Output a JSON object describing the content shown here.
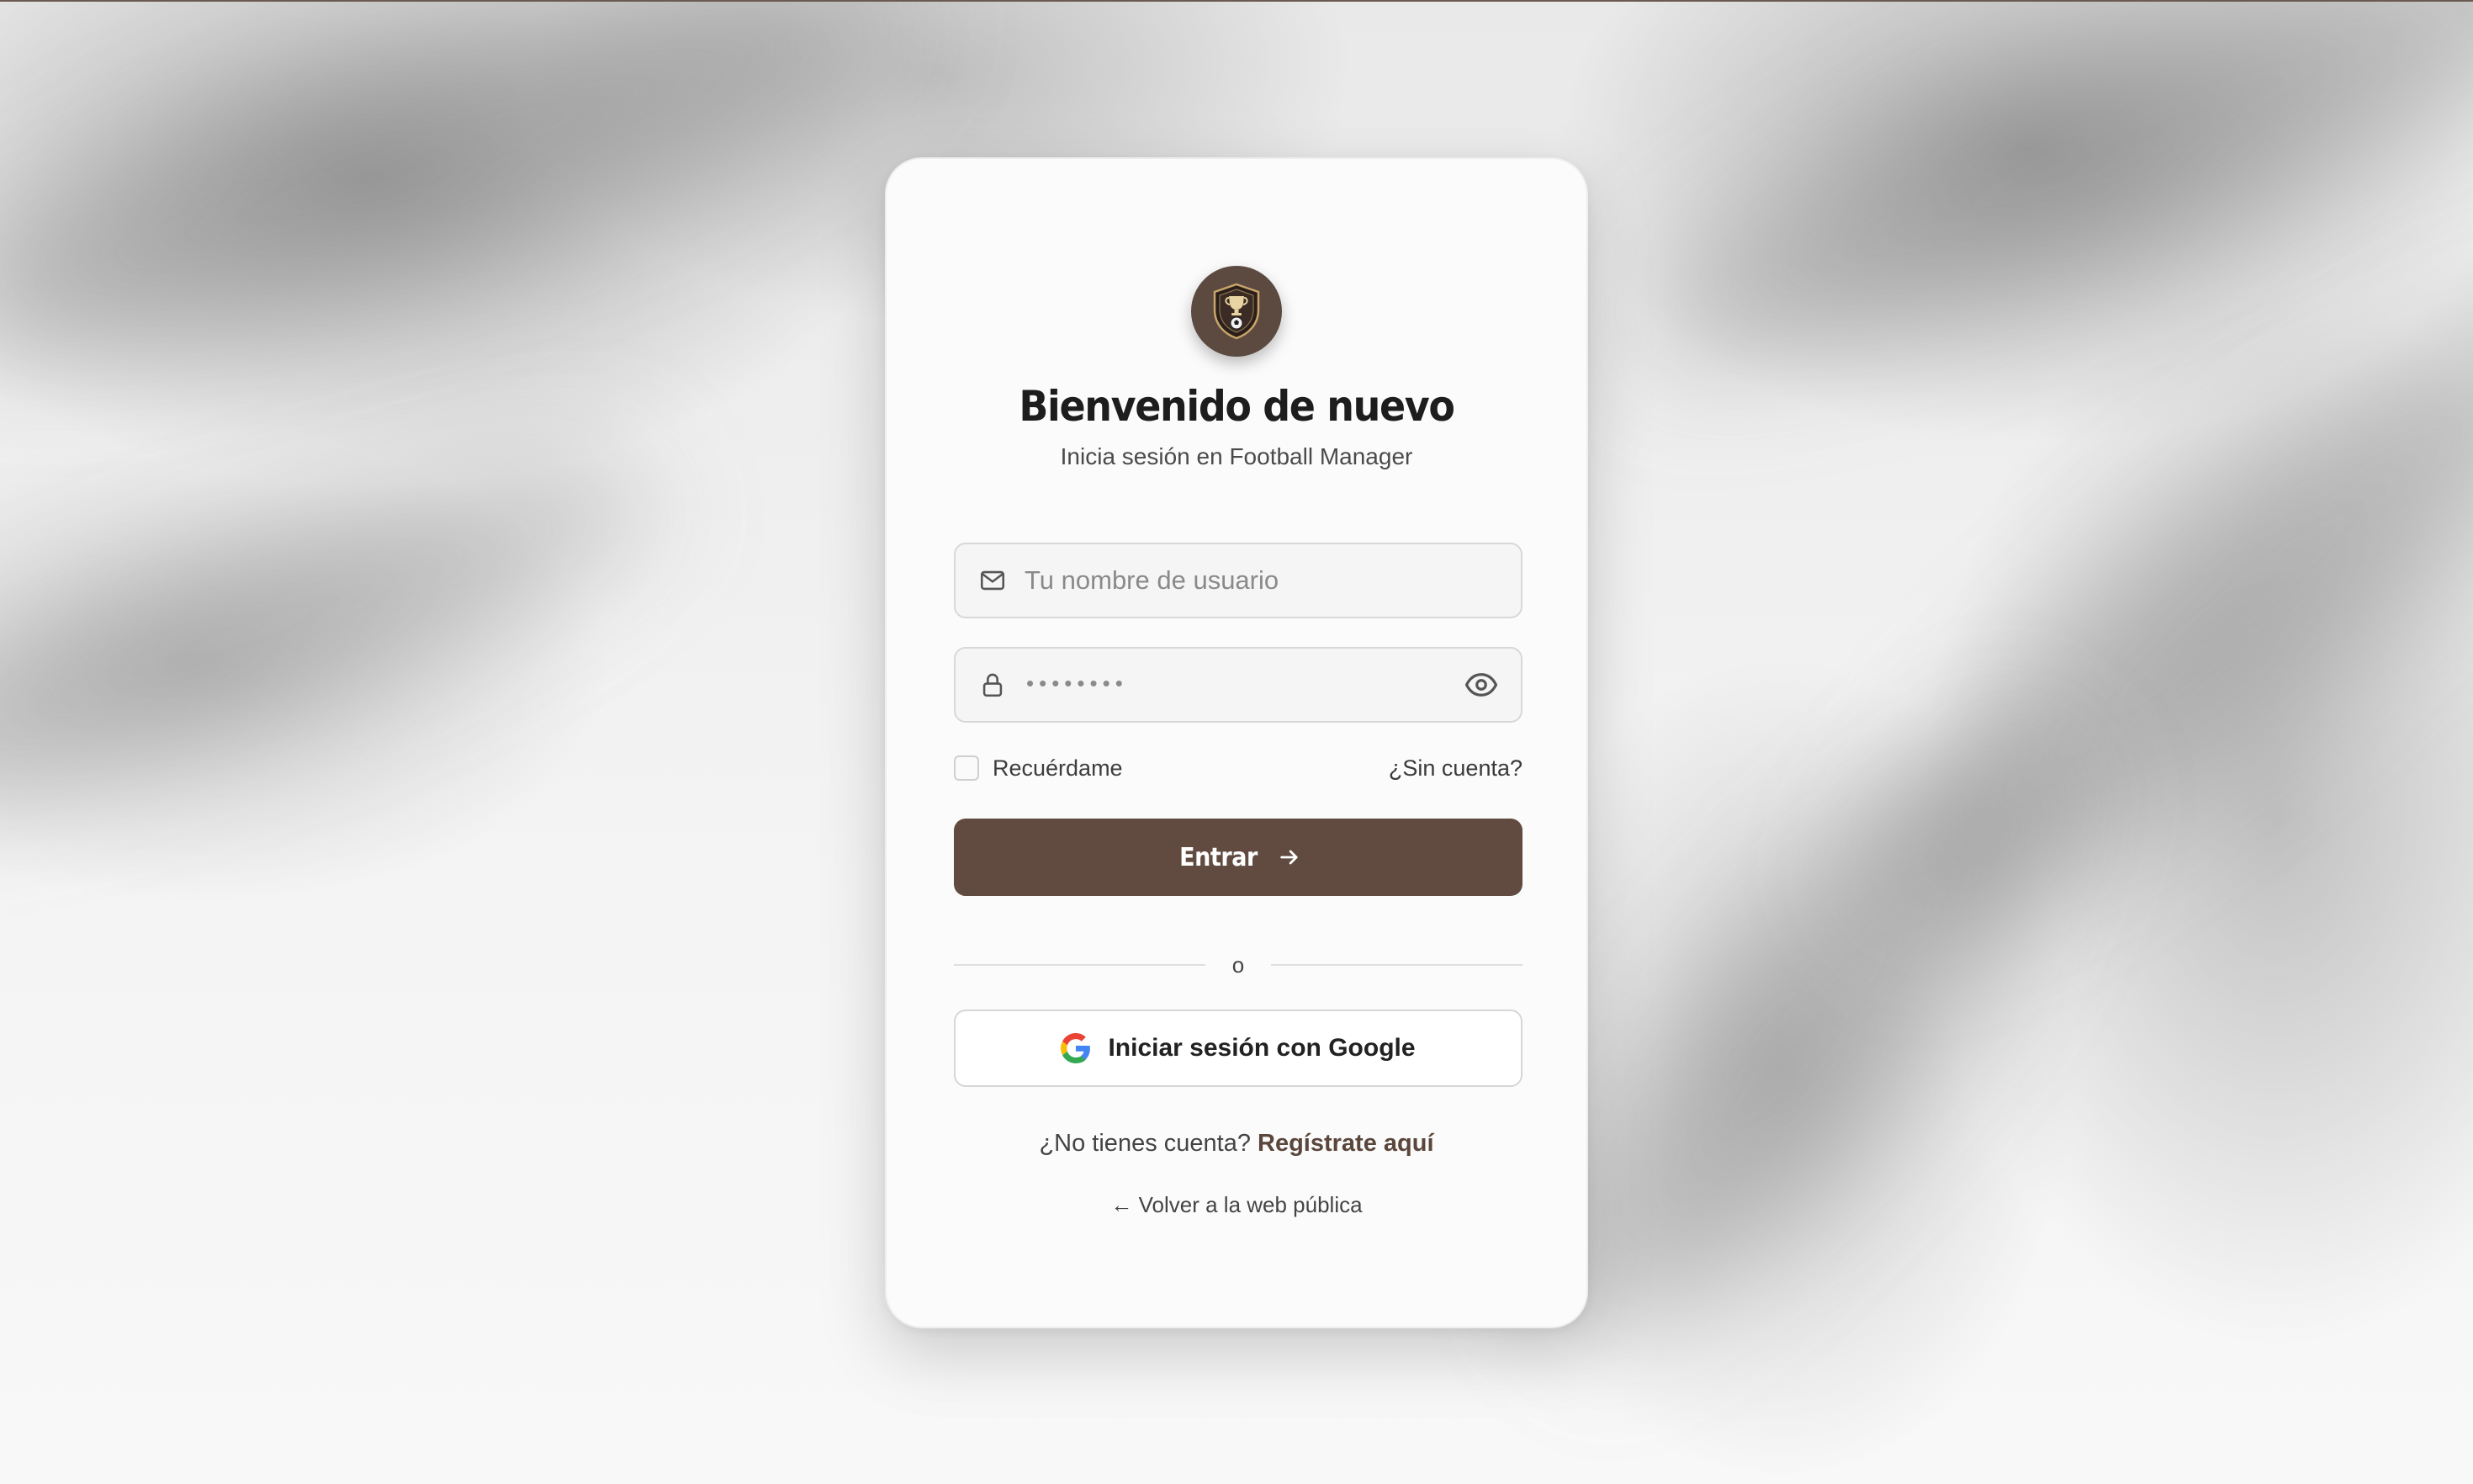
{
  "login": {
    "title": "Bienvenido de nuevo",
    "subtitle": "Inicia sesión en Football Manager",
    "username_placeholder": "Tu nombre de usuario",
    "password_mask": "••••••••",
    "remember_label": "Recuérdame",
    "no_account_link": "¿Sin cuenta?",
    "submit_label": "Entrar",
    "separator": "o",
    "google_label": "Iniciar sesión con Google",
    "signup_prompt": "¿No tienes cuenta?",
    "signup_link": "Regístrate aquí",
    "back_link": "← Volver a la web pública"
  },
  "icons": {
    "logo": "trophy-shield-icon",
    "username": "mail-icon",
    "password": "lock-icon",
    "toggle_password": "eye-icon",
    "submit": "arrow-right-icon",
    "google": "google-icon"
  },
  "colors": {
    "accent": "#614b41",
    "logo_bg": "#5c4a41",
    "signup_link": "#5b463c"
  }
}
